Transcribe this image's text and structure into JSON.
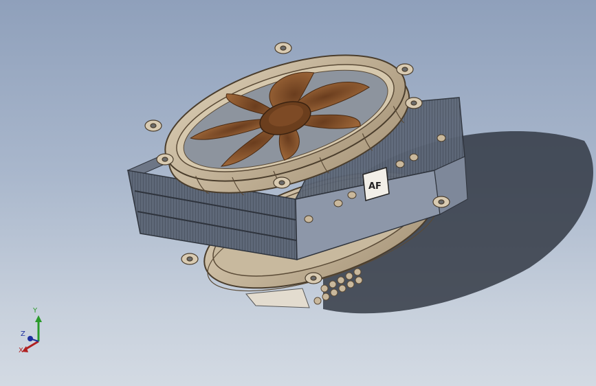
{
  "viewport": {
    "background_top": "#8fa0bb",
    "background_bottom": "#d3dae3"
  },
  "model": {
    "fan_frame_color": "#bfae93",
    "fan_blade_color": "#7a4a26",
    "fin_color": "#5e6878",
    "heatpipe_color": "#c9b89c",
    "logo_text": "AF"
  },
  "triad": {
    "y_label": "Y",
    "z_label": "Z",
    "x_label": "X",
    "y_color": "#2a9a2a",
    "z_color": "#1d2f9e",
    "x_color": "#b02020"
  }
}
